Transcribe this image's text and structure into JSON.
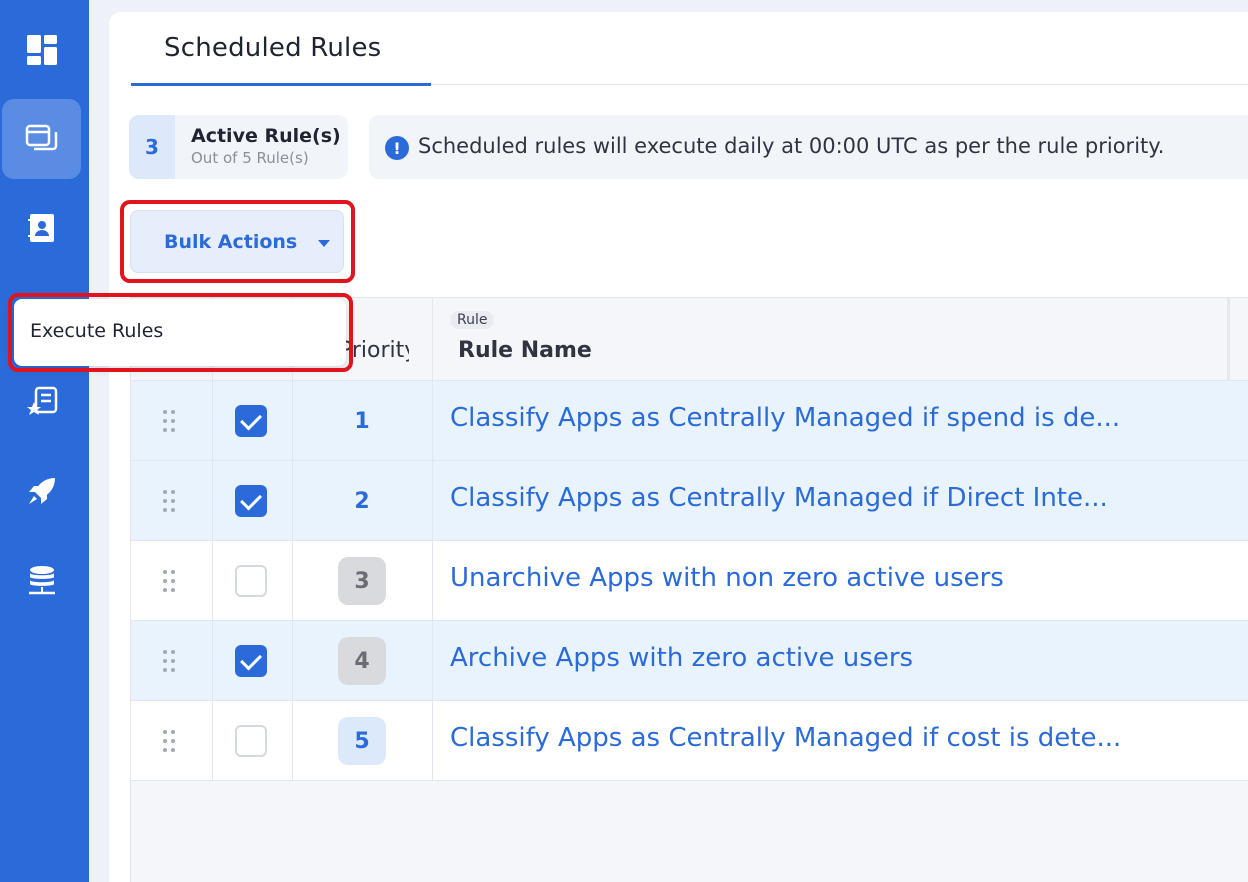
{
  "sidebar": {
    "items": [
      {
        "icon": "dashboard-icon"
      },
      {
        "icon": "windows-icon",
        "active": true
      },
      {
        "icon": "contact-book-icon"
      },
      {
        "icon": "starred-document-icon"
      },
      {
        "icon": "rocket-icon"
      },
      {
        "icon": "database-icon"
      }
    ]
  },
  "header": {
    "tab_title": "Scheduled Rules"
  },
  "summary": {
    "active_count": "3",
    "active_label": "Active Rule(s)",
    "out_of_label": "Out of 5 Rule(s)"
  },
  "info": {
    "icon": "!",
    "message": "Scheduled rules will execute daily at 00:00 UTC as per the rule priority."
  },
  "toolbar": {
    "bulk_actions_label": "Bulk Actions"
  },
  "menu": {
    "items": [
      "Execute Rules"
    ]
  },
  "table": {
    "columns": {
      "priority": "Priority",
      "rule_chip": "Rule",
      "rule_name": "Rule Name"
    },
    "rows": [
      {
        "checked": true,
        "priority": "1",
        "name": "Classify Apps as Centrally Managed if spend is de..."
      },
      {
        "checked": true,
        "priority": "2",
        "name": "Classify Apps as Centrally Managed if Direct Inte..."
      },
      {
        "checked": false,
        "priority": "3",
        "name": "Unarchive Apps with non zero active users"
      },
      {
        "checked": true,
        "priority": "4",
        "name": "Archive Apps with zero active users"
      },
      {
        "checked": false,
        "priority": "5",
        "name": "Classify Apps as Centrally Managed if cost is dete..."
      }
    ]
  },
  "colors": {
    "accent": "#2b6bd9",
    "selected_row": "#e8f3fd",
    "highlight": "#e0141e"
  }
}
